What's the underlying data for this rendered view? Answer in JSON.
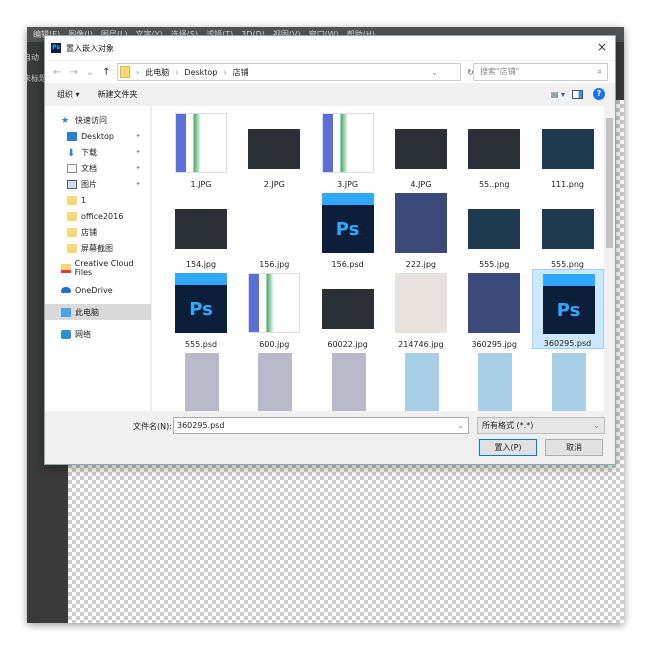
{
  "app": {
    "menu": [
      "编辑(E)",
      "图像(I)",
      "图层(L)",
      "文字(Y)",
      "选择(S)",
      "滤镜(T)",
      "3D(D)",
      "视图(V)",
      "窗口(W)",
      "帮助(H)"
    ],
    "left_labels": [
      "自动",
      "未标题"
    ]
  },
  "dialog": {
    "title": "置入嵌入对象",
    "breadcrumb": [
      "此电脑",
      "Desktop",
      "店铺"
    ],
    "search_placeholder": "搜索\"店铺\"",
    "toolbar": {
      "organize": "组织 ▾",
      "new_folder": "新建文件夹"
    },
    "sidebar": [
      {
        "label": "快速访问",
        "icon": "star-icon",
        "pinned": false
      },
      {
        "label": "Desktop",
        "icon": "desktop-icon",
        "pinned": true
      },
      {
        "label": "下载",
        "icon": "download-icon",
        "pinned": true
      },
      {
        "label": "文档",
        "icon": "document-icon",
        "pinned": true
      },
      {
        "label": "图片",
        "icon": "pictures-icon",
        "pinned": true
      },
      {
        "label": "1",
        "icon": "folder-icon",
        "pinned": false
      },
      {
        "label": "office2016",
        "icon": "folder-icon",
        "pinned": false
      },
      {
        "label": "店铺",
        "icon": "folder-icon",
        "pinned": false
      },
      {
        "label": "屏幕截图",
        "icon": "folder-icon",
        "pinned": false
      },
      {
        "label": "Creative Cloud Files",
        "icon": "creative-cloud-icon",
        "pinned": false
      },
      {
        "label": "OneDrive",
        "icon": "cloud-icon",
        "pinned": false
      },
      {
        "label": "此电脑",
        "icon": "computer-icon",
        "pinned": false,
        "selected": true
      },
      {
        "label": "网络",
        "icon": "network-icon",
        "pinned": false
      }
    ],
    "files": [
      {
        "name": "1.JPG",
        "kind": "doc"
      },
      {
        "name": "2.JPG",
        "kind": "dark"
      },
      {
        "name": "3.JPG",
        "kind": "doc"
      },
      {
        "name": "4.JPG",
        "kind": "dark"
      },
      {
        "name": "55..png",
        "kind": "dark"
      },
      {
        "name": "111.png",
        "kind": "teal"
      },
      {
        "name": "154.jpg",
        "kind": "dark"
      },
      {
        "name": "156.jpg",
        "kind": "blank"
      },
      {
        "name": "156.psd",
        "kind": "psd"
      },
      {
        "name": "222.jpg",
        "kind": "anime"
      },
      {
        "name": "555.jpg",
        "kind": "teal"
      },
      {
        "name": "555.png",
        "kind": "teal"
      },
      {
        "name": "555.psd",
        "kind": "psd"
      },
      {
        "name": "600.jpg",
        "kind": "doc"
      },
      {
        "name": "60022.jpg",
        "kind": "dark"
      },
      {
        "name": "214746.jpg",
        "kind": "photo"
      },
      {
        "name": "360295.jpg",
        "kind": "anime"
      },
      {
        "name": "360295.psd",
        "kind": "psd",
        "selected": true
      },
      {
        "name": "",
        "kind": "flower-gray"
      },
      {
        "name": "",
        "kind": "flower-gray"
      },
      {
        "name": "",
        "kind": "flower-gray"
      },
      {
        "name": "",
        "kind": "flower-blue"
      },
      {
        "name": "",
        "kind": "flower-blue"
      },
      {
        "name": "",
        "kind": "flower-blue"
      }
    ],
    "filename_label": "文件名(N):",
    "filename_value": "360295.psd",
    "filetype": "所有格式 (*.*)",
    "place_button": "置入(P)",
    "cancel_button": "取消",
    "close": "×"
  }
}
